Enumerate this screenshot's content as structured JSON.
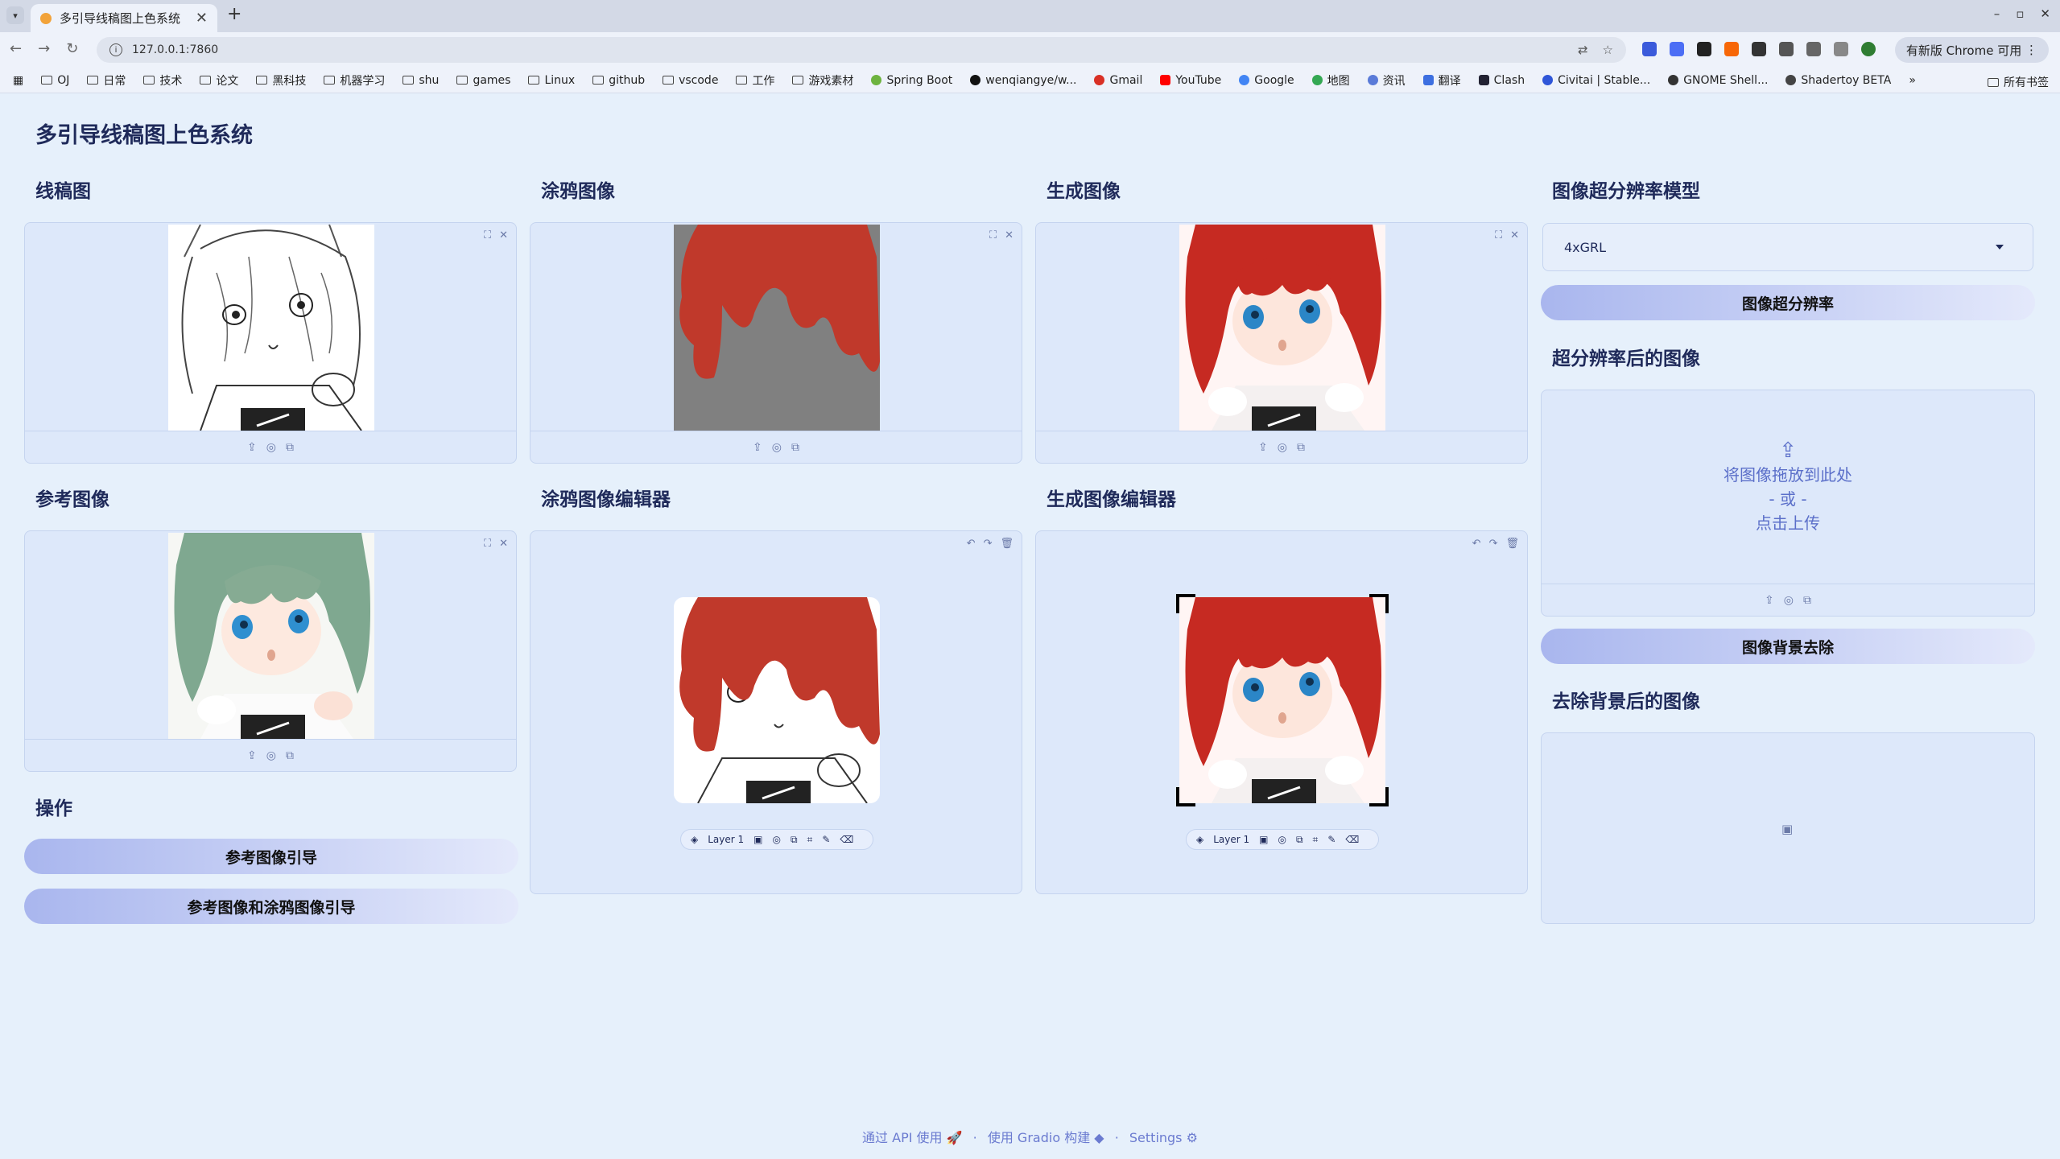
{
  "browser": {
    "tab_title": "多引导线稿图上色系统",
    "tab_close": "✕",
    "new_tab": "+",
    "url": "127.0.0.1:7860",
    "update_label": "有新版 Chrome 可用",
    "bookmarks": [
      "OJ",
      "日常",
      "技术",
      "论文",
      "黑科技",
      "机器学习",
      "shu",
      "games",
      "Linux",
      "github",
      "vscode",
      "工作",
      "游戏素材",
      "Spring Boot",
      "wenqiangye/w...",
      "Gmail",
      "YouTube",
      "Google",
      "地图",
      "资讯",
      "翻译",
      "Clash",
      "Civitai | Stable...",
      "GNOME Shell...",
      "Shadertoy BETA"
    ],
    "bookmarks_more": "»",
    "all_bookmarks": "所有书签"
  },
  "page": {
    "title": "多引导线稿图上色系统"
  },
  "sections": {
    "lineart": "线稿图",
    "scribble": "涂鸦图像",
    "generated": "生成图像",
    "sr_model_title": "图像超分辨率模型",
    "reference": "参考图像",
    "scribble_editor": "涂鸦图像编辑器",
    "generated_editor": "生成图像编辑器",
    "sr_result": "超分辨率后的图像",
    "operations": "操作",
    "bg_removed": "去除背景后的图像"
  },
  "controls": {
    "sr_model_value": "4xGRL",
    "sr_button": "图像超分辨率",
    "bg_remove_button": "图像背景去除",
    "ref_guide_button": "参考图像引导",
    "ref_scribble_guide_button": "参考图像和涂鸦图像引导",
    "upload_drop": "将图像拖放到此处",
    "upload_or": "- 或 -",
    "upload_click": "点击上传",
    "layer_label": "Layer 1"
  },
  "footer": {
    "api": "通过 API 使用",
    "gradio": "使用 Gradio 构建",
    "settings": "Settings",
    "sep": "·"
  },
  "colors": {
    "page_bg": "#e6f0fb",
    "panel_bg": "#dde8fa",
    "accent": "#6b7bd0",
    "scribble_red": "#c0392b"
  }
}
